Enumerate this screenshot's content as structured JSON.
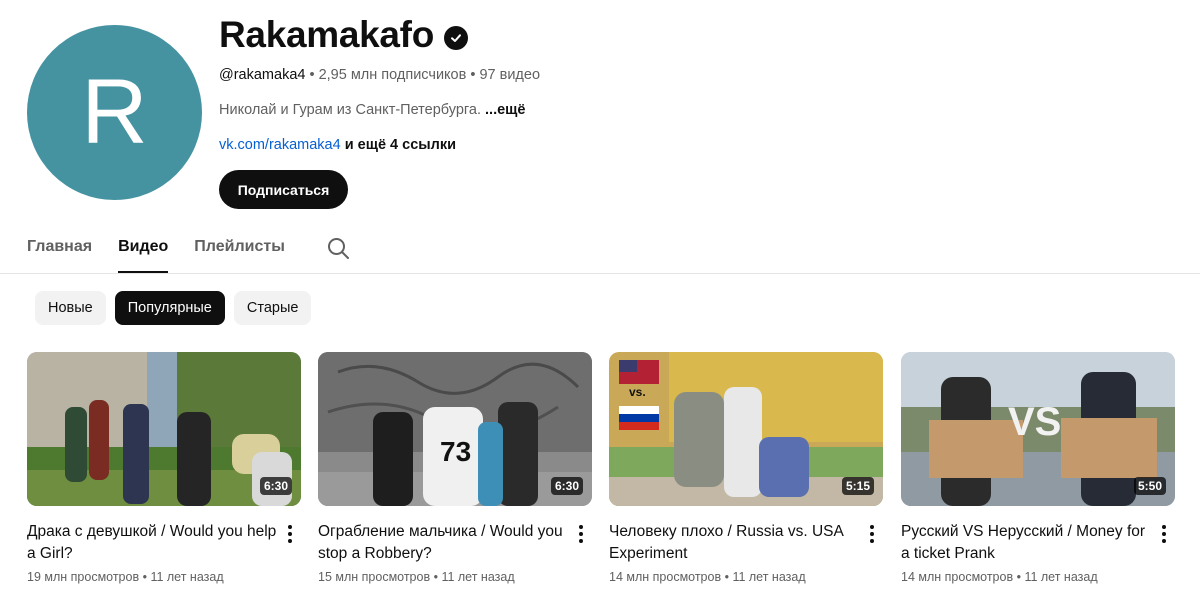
{
  "channel": {
    "avatar_letter": "R",
    "avatar_color": "#4593a1",
    "name": "Rakamakafo",
    "handle": "@rakamaka4",
    "meta_rest": " • 2,95 млн подписчиков • 97 видео",
    "description": "Николай и Гурам из Санкт-Петербурга.",
    "more": "...ещё",
    "link": "vk.com/rakamaka4",
    "links_extra": " и ещё 4 ссылки",
    "subscribe": "Подписаться"
  },
  "tabs": [
    {
      "label": "Главная"
    },
    {
      "label": "Видео"
    },
    {
      "label": "Плейлисты"
    }
  ],
  "chips": [
    {
      "label": "Новые"
    },
    {
      "label": "Популярные"
    },
    {
      "label": "Старые"
    }
  ],
  "videos": [
    {
      "title": "Драка с девушкой / Would you help a Girl?",
      "views": "19 млн просмотров",
      "age": "11 лет назад",
      "duration": "6:30"
    },
    {
      "title": "Ограбление мальчика / Would you stop a Robbery?",
      "views": "15 млн просмотров",
      "age": "11 лет назад",
      "duration": "6:30",
      "thumb_text": "73"
    },
    {
      "title": "Человеку плохо / Russia vs. USA Experiment",
      "views": "14 млн просмотров",
      "age": "11 лет назад",
      "duration": "5:15",
      "thumb_text": "vs."
    },
    {
      "title": "Русский VS Нерусский / Money for a ticket Prank",
      "views": "14 млн просмотров",
      "age": "11 лет назад",
      "duration": "5:50",
      "thumb_text": "VS"
    }
  ]
}
